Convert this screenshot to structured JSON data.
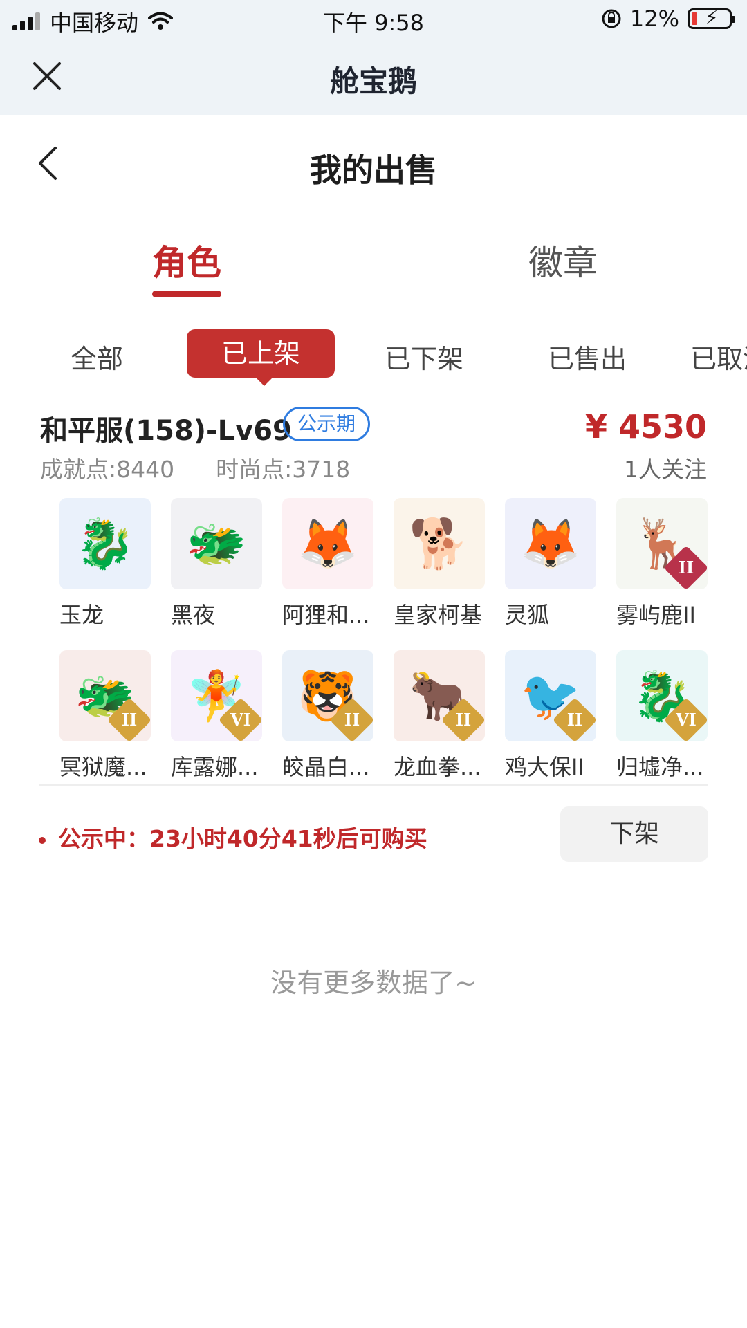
{
  "status_bar": {
    "carrier": "中国移动",
    "time": "下午 9:58",
    "battery_percent": "12%"
  },
  "app_header": {
    "title": "舱宝鹅"
  },
  "page_header": {
    "title": "我的出售"
  },
  "main_tabs": [
    {
      "label": "角色",
      "active": true
    },
    {
      "label": "徽章",
      "active": false
    }
  ],
  "filters": [
    {
      "label": "全部",
      "active": false
    },
    {
      "label": "已上架",
      "active": true
    },
    {
      "label": "已下架",
      "active": false
    },
    {
      "label": "已售出",
      "active": false
    },
    {
      "label": "已取消",
      "active": false
    }
  ],
  "listing": {
    "server": "和平服(158)-Lv69",
    "badge": "公示期",
    "price": "¥ 4530",
    "achievement_label": "成就点:",
    "achievement_value": "8440",
    "fashion_label": "时尚点:",
    "fashion_value": "3718",
    "followers": "1人关注",
    "pets": [
      {
        "name": "玉龙",
        "icon": "dragon-icon",
        "bg": "#eaf1fb",
        "glyph": "🐉",
        "grade": ""
      },
      {
        "name": "黑夜",
        "icon": "black-dragon-icon",
        "bg": "#f1f1f4",
        "glyph": "🐲",
        "grade": ""
      },
      {
        "name": "阿狸和...",
        "icon": "fox-cloud-icon",
        "bg": "#fdf0f3",
        "glyph": "🦊",
        "grade": ""
      },
      {
        "name": "皇家柯基",
        "icon": "corgi-icon",
        "bg": "#fbf4ea",
        "glyph": "🐕",
        "grade": ""
      },
      {
        "name": "灵狐",
        "icon": "spirit-fox-icon",
        "bg": "#eef0fb",
        "glyph": "🦊",
        "grade": ""
      },
      {
        "name": "雾屿鹿II",
        "icon": "deer-icon",
        "bg": "#f5f7f2",
        "glyph": "🦌",
        "grade": "II",
        "grade_color": "red"
      },
      {
        "name": "冥狱魔...",
        "icon": "demon-beast-icon",
        "bg": "#f8ecea",
        "glyph": "🐲",
        "grade": "II",
        "grade_color": "gold"
      },
      {
        "name": "库露娜...",
        "icon": "kuluna-icon",
        "bg": "#f6f0fb",
        "glyph": "🧚",
        "grade": "VI",
        "grade_color": "gold"
      },
      {
        "name": "皎晶白...",
        "icon": "white-tiger-icon",
        "bg": "#e9f0f8",
        "glyph": "🐯",
        "grade": "II",
        "grade_color": "gold"
      },
      {
        "name": "龙血拳...",
        "icon": "dragon-blood-icon",
        "bg": "#f9ece8",
        "glyph": "🐂",
        "grade": "II",
        "grade_color": "gold"
      },
      {
        "name": "鸡大保II",
        "icon": "blue-bird-icon",
        "bg": "#e8f1fb",
        "glyph": "🐦",
        "grade": "II",
        "grade_color": "gold"
      },
      {
        "name": "归墟净...",
        "icon": "sea-dragon-icon",
        "bg": "#eaf7f7",
        "glyph": "🐉",
        "grade": "VI",
        "grade_color": "gold"
      }
    ],
    "notice_label": "公示中：",
    "notice_text": "23小时40分41秒后可购买",
    "delist_label": "下架"
  },
  "footer_text": "没有更多数据了~",
  "colors": {
    "accent": "#c0282a",
    "badge_blue": "#2f7ce0",
    "header_bg": "#eef3f7"
  }
}
